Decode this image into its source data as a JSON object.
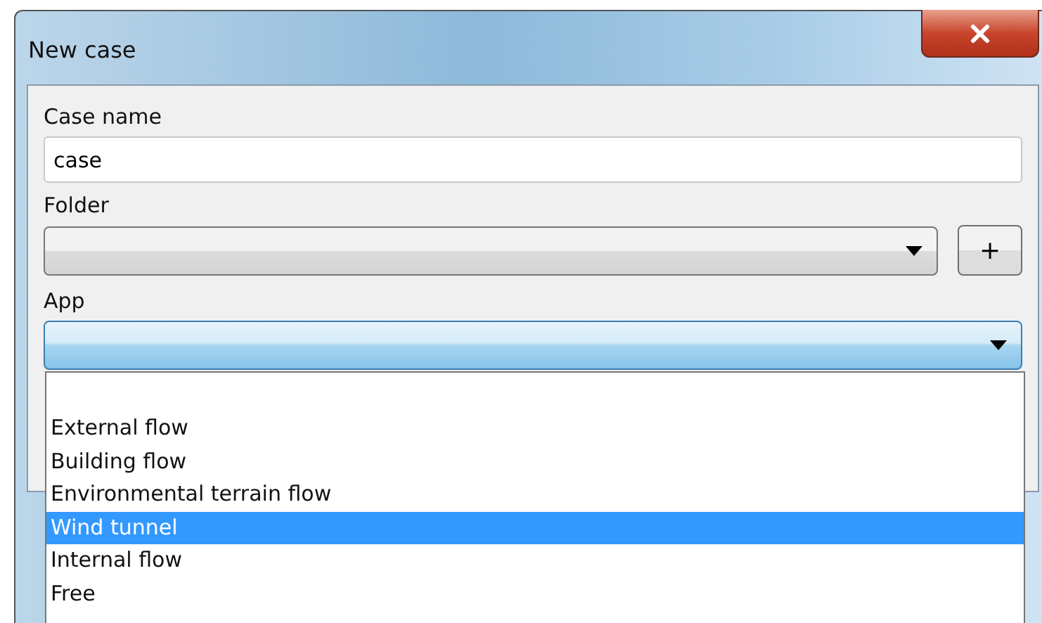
{
  "window": {
    "title": "New case"
  },
  "case_name": {
    "label": "Case name",
    "value": "case"
  },
  "folder": {
    "label": "Folder",
    "add_button": "+"
  },
  "app": {
    "label": "App",
    "expanded": true,
    "options": [
      {
        "label": "External flow",
        "selected": false
      },
      {
        "label": "Building flow",
        "selected": false
      },
      {
        "label": "Environmental terrain flow",
        "selected": false
      },
      {
        "label": "Wind tunnel",
        "selected": true
      },
      {
        "label": "Internal flow",
        "selected": false
      },
      {
        "label": "Free",
        "selected": false
      }
    ]
  }
}
